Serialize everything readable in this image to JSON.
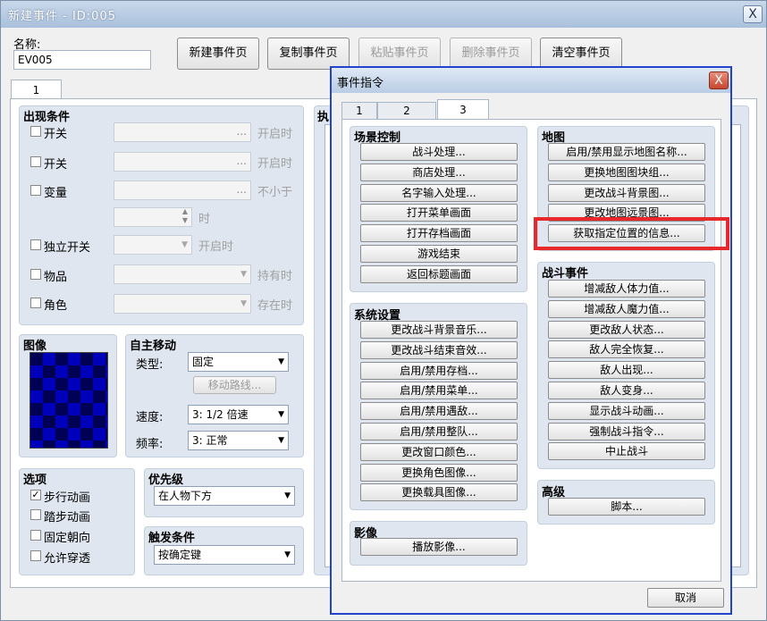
{
  "window": {
    "title": "新建事件 - ID:005",
    "close_label": "X"
  },
  "name_field": {
    "label": "名称:",
    "value": "EV005"
  },
  "page_buttons": {
    "new": "新建事件页",
    "copy": "复制事件页",
    "paste": "粘贴事件页",
    "delete": "删除事件页",
    "clear": "清空事件页"
  },
  "page_tabs": [
    "1"
  ],
  "conditions": {
    "title": "出现条件",
    "switch1": {
      "label": "开关",
      "suffix": "开启时"
    },
    "switch2": {
      "label": "开关",
      "suffix": "开启时"
    },
    "variable": {
      "label": "变量",
      "suffix": "不小于"
    },
    "var_time": "时",
    "self_switch": {
      "label": "独立开关",
      "suffix": "开启时"
    },
    "item": {
      "label": "物品",
      "suffix": "持有时"
    },
    "actor": {
      "label": "角色",
      "suffix": "存在时"
    },
    "ellipsis": "..."
  },
  "image": {
    "title": "图像"
  },
  "move": {
    "title": "自主移动",
    "type_label": "类型:",
    "type_value": "固定",
    "route_button": "移动路线...",
    "speed_label": "速度:",
    "speed_value": "3: 1/2 倍速",
    "freq_label": "频率:",
    "freq_value": "3: 正常"
  },
  "options": {
    "title": "选项",
    "walk_anim": "步行动画",
    "step_anim": "踏步动画",
    "fixed_dir": "固定朝向",
    "through": "允许穿透"
  },
  "priority": {
    "title": "优先级",
    "value": "在人物下方"
  },
  "trigger": {
    "title": "触发条件",
    "value": "按确定键"
  },
  "contents_title": "执",
  "dialog": {
    "title": "事件指令",
    "tabs": [
      "1",
      "2",
      "3"
    ],
    "scene": {
      "title": "场景控制",
      "items": [
        "战斗处理...",
        "商店处理...",
        "名字输入处理...",
        "打开菜单画面",
        "打开存档画面",
        "游戏结束",
        "返回标题画面"
      ]
    },
    "system": {
      "title": "系统设置",
      "items": [
        "更改战斗背景音乐...",
        "更改战斗结束音效...",
        "启用/禁用存档...",
        "启用/禁用菜单...",
        "启用/禁用遇敌...",
        "启用/禁用整队...",
        "更改窗口颜色...",
        "更换角色图像...",
        "更换载具图像..."
      ]
    },
    "movie": {
      "title": "影像",
      "items": [
        "播放影像..."
      ]
    },
    "map": {
      "title": "地图",
      "items": [
        "启用/禁用显示地图名称...",
        "更换地图图块组...",
        "更改战斗背景图...",
        "更改地图远景图...",
        "获取指定位置的信息..."
      ]
    },
    "battle": {
      "title": "战斗事件",
      "items": [
        "增减敌人体力值...",
        "增减敌人魔力值...",
        "更改敌人状态...",
        "敌人完全恢复...",
        "敌人出现...",
        "敌人变身...",
        "显示战斗动画...",
        "强制战斗指令...",
        "中止战斗"
      ]
    },
    "advanced": {
      "title": "高级",
      "items": [
        "脚本..."
      ]
    },
    "cancel": "取消"
  }
}
